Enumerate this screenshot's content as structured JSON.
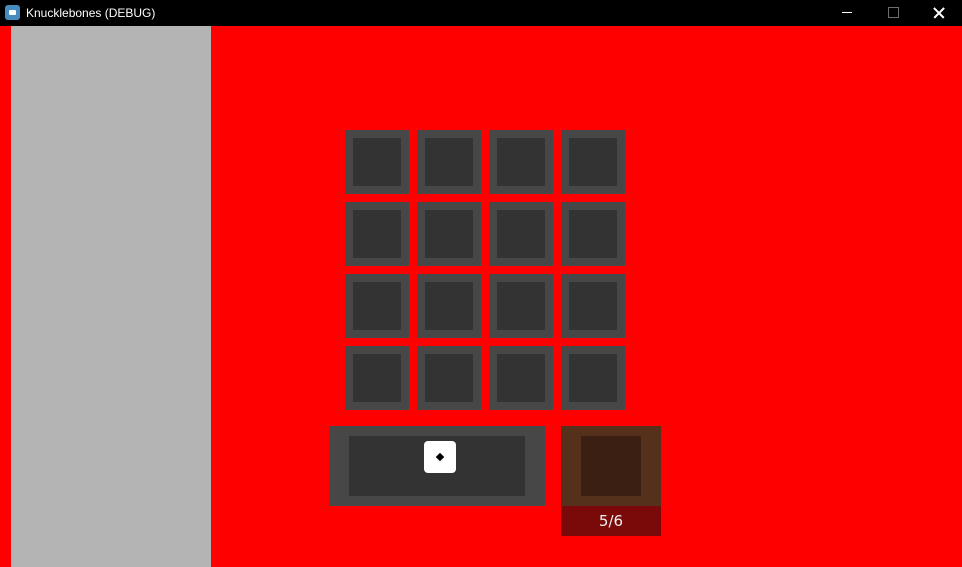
{
  "window": {
    "title": "Knucklebones (DEBUG)",
    "icon": "godot-engine-icon"
  },
  "board": {
    "rows": 4,
    "columns": 4,
    "cells_filled": 0
  },
  "tray": {
    "die_face": 1
  },
  "discard": {
    "counter": "5/6"
  },
  "colors": {
    "background": "#ff0000",
    "side_panel": "#b4b4b4",
    "slot_frame": "#474747",
    "slot_inner": "#333333",
    "discard_bin": "#55301b",
    "counter_bg": "#7a0a0a"
  }
}
